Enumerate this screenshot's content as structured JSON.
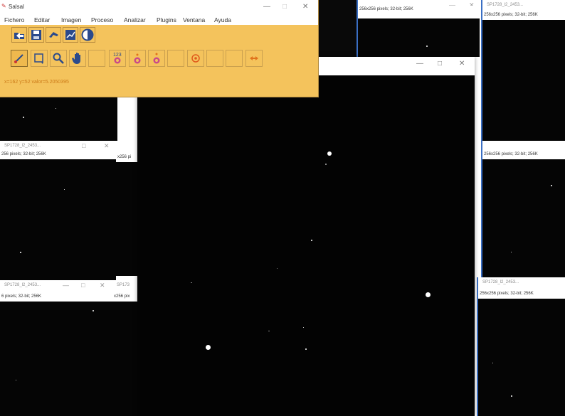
{
  "main_window": {
    "title": "Salsal",
    "menu": [
      "Fichero",
      "Editar",
      "Imagen",
      "Proceso",
      "Analizar",
      "Plugins",
      "Ventana",
      "Ayuda"
    ],
    "status": "x=162 y=52 valor=5.2050395",
    "controls": {
      "minimize": "—",
      "maximize": "□",
      "close": "✕"
    }
  },
  "tools": {
    "row1": [
      "open-icon",
      "save-icon",
      "undo-icon",
      "histogram-icon",
      "contrast-icon"
    ],
    "row2": [
      "line-icon",
      "rectangle-icon",
      "magnifier-icon",
      "hand-icon",
      "counter-123-icon",
      "pin-single-icon",
      "pin-double-icon",
      "",
      "target-icon",
      "",
      "",
      "arrows-icon"
    ],
    "counter_label": "123"
  },
  "image_windows": {
    "top_mid": {
      "info": "256x256 pixels; 32-bit; 256K"
    },
    "top_right": {
      "title": "SP1728_l2_2453...",
      "info": "256x256 pixels; 32-bit; 256K"
    },
    "mid_left": {
      "title": "SP1728_l2_2453...",
      "info": "256 pixels; 32-bit; 256K"
    },
    "mid_left_back": {
      "info": "x256 pi"
    },
    "mid_right": {
      "info": "256x256 pixels; 32-bit; 256K"
    },
    "bot_left": {
      "title": "SP1728_l2_2453...",
      "info": "6 pixels; 32-bit; 256K"
    },
    "bot_left_back": {
      "title": "SP173",
      "info": "x256 pix"
    },
    "bot_right": {
      "title": "SP1728_l2_2453...",
      "info": "256x256 pixels; 32-bit; 256K"
    },
    "active": {
      "controls": {
        "minimize": "—",
        "maximize": "□",
        "close": "✕"
      }
    }
  },
  "colors": {
    "toolbar_bg": "#f4c35c",
    "status_text": "#cc7a18",
    "image_bg": "#050505"
  }
}
